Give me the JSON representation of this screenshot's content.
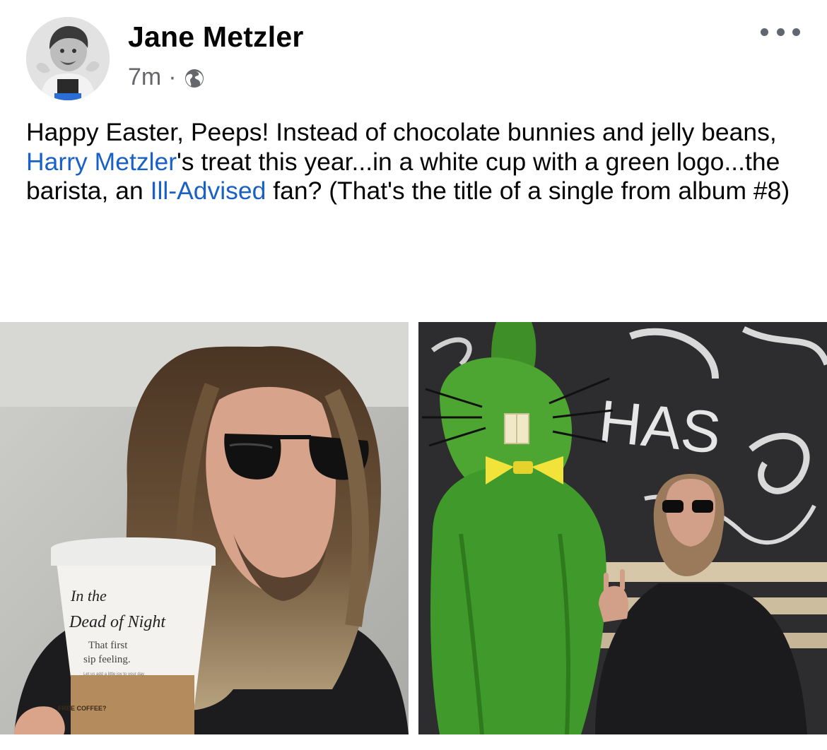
{
  "post": {
    "author": "Jane Metzler",
    "time": "7m",
    "separator": "·",
    "privacy_icon": "globe-icon",
    "more_icon": "more-options-icon",
    "text": {
      "part1": "Happy Easter, Peeps! Instead of chocolate bunnies and jelly beans, ",
      "mention": "Harry Metzler",
      "part2": "'s treat this year...in a white cup with a green logo...the barista, an ",
      "hashtag": "Ill-Advised",
      "part3": " fan? (That's the title of a single from album #8)"
    },
    "photos": [
      {
        "cup_writing_line1": "In the",
        "cup_writing_line2": "Dead of Night",
        "cup_print_line1": "That first",
        "cup_print_line2": "sip feeling.",
        "cup_small_print": "Let us add a little joy to your day",
        "cup_sleeve_text": "FREE COFFEE?"
      },
      {
        "wall_text": "HAS"
      }
    ]
  },
  "colors": {
    "link": "#1a61c7",
    "meta": "#65676b",
    "name": "#050505"
  }
}
